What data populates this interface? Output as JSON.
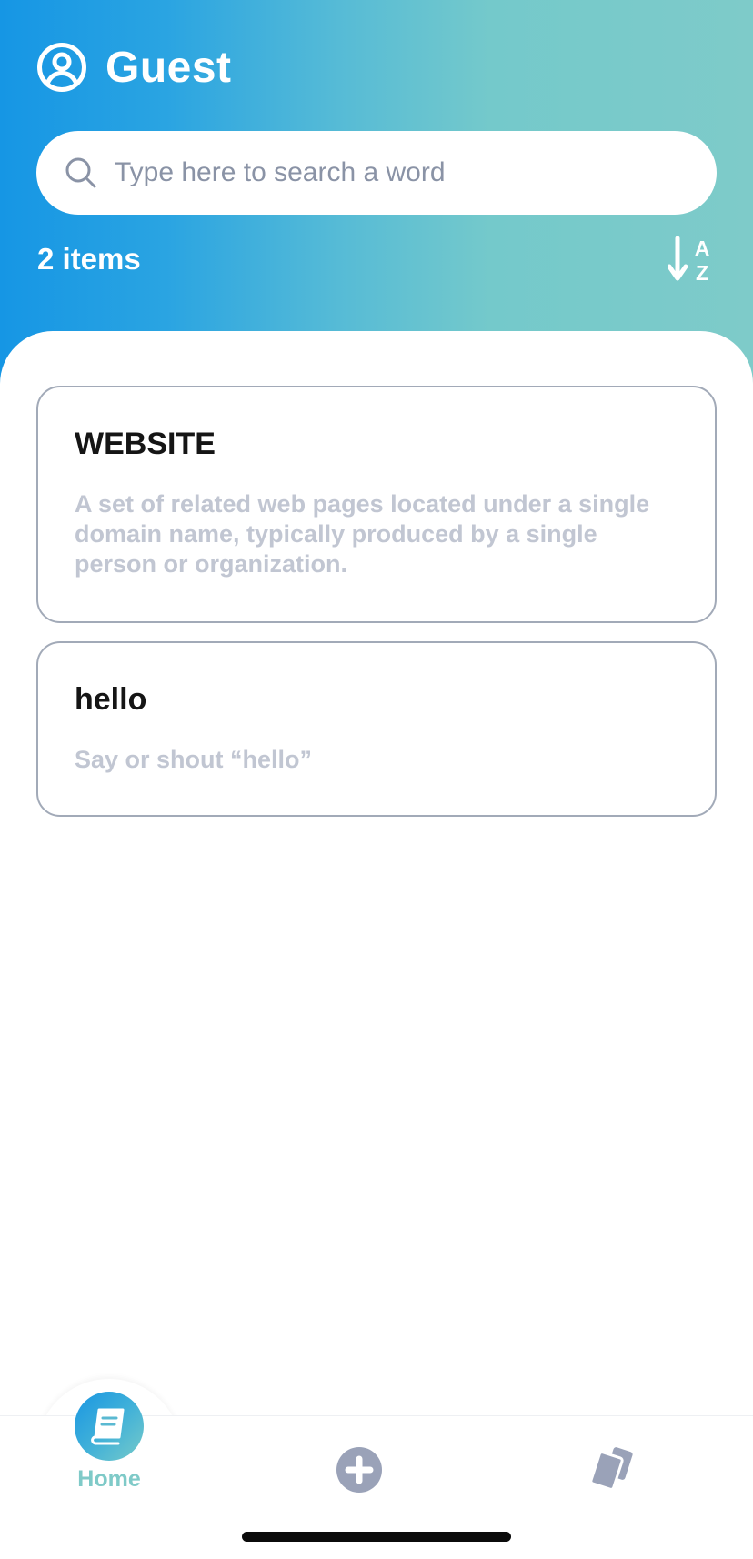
{
  "header": {
    "username": "Guest",
    "user_icon": "user-circle-icon"
  },
  "search": {
    "placeholder": "Type here to search a word",
    "value": "",
    "icon": "search-icon"
  },
  "list": {
    "count_label": "2 items",
    "sort_icon": "sort-a-z-icon"
  },
  "words": [
    {
      "term": "WEBSITE",
      "definition": "A set of related web pages located under a single domain name, typically produced by a single person or organization."
    },
    {
      "term": "hello",
      "definition": "Say or shout “hello”"
    }
  ],
  "nav": {
    "home_label": "Home",
    "home_icon": "book-icon",
    "add_icon": "plus-circle-icon",
    "cards_icon": "cards-icon"
  },
  "colors": {
    "gradient_start": "#1696e4",
    "gradient_end": "#7ecbc9",
    "card_border": "#a2aab8",
    "definition_text": "#c1c6d2",
    "nav_inactive": "#9aa2b8",
    "home_label": "#7fcac8"
  }
}
